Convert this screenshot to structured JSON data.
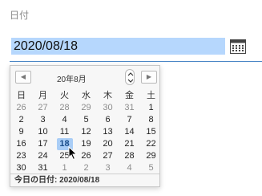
{
  "field": {
    "label": "日付",
    "value": "2020/08/18"
  },
  "calendar_button": {
    "icon": "calendar-icon"
  },
  "popup": {
    "month_label": "20年8月",
    "prev_icon": "triangle-left-icon",
    "next_icon": "triangle-right-icon",
    "weekdays": [
      "日",
      "月",
      "火",
      "水",
      "木",
      "金",
      "土"
    ],
    "weeks": [
      [
        {
          "d": "26",
          "o": true
        },
        {
          "d": "27",
          "o": true
        },
        {
          "d": "28",
          "o": true
        },
        {
          "d": "29",
          "o": true
        },
        {
          "d": "30",
          "o": true
        },
        {
          "d": "31",
          "o": true
        },
        {
          "d": "1"
        }
      ],
      [
        {
          "d": "2"
        },
        {
          "d": "3"
        },
        {
          "d": "4"
        },
        {
          "d": "5"
        },
        {
          "d": "6"
        },
        {
          "d": "7"
        },
        {
          "d": "8"
        }
      ],
      [
        {
          "d": "9"
        },
        {
          "d": "10"
        },
        {
          "d": "11"
        },
        {
          "d": "12"
        },
        {
          "d": "13"
        },
        {
          "d": "14"
        },
        {
          "d": "15"
        }
      ],
      [
        {
          "d": "16"
        },
        {
          "d": "17"
        },
        {
          "d": "18",
          "s": true
        },
        {
          "d": "19"
        },
        {
          "d": "20"
        },
        {
          "d": "21"
        },
        {
          "d": "22"
        }
      ],
      [
        {
          "d": "23"
        },
        {
          "d": "24"
        },
        {
          "d": "25"
        },
        {
          "d": "26"
        },
        {
          "d": "27"
        },
        {
          "d": "28"
        },
        {
          "d": "29"
        }
      ],
      [
        {
          "d": "30"
        },
        {
          "d": "31"
        },
        {
          "d": "1",
          "o": true
        },
        {
          "d": "2",
          "o": true
        },
        {
          "d": "3",
          "o": true
        },
        {
          "d": "4",
          "o": true
        },
        {
          "d": "5",
          "o": true
        }
      ]
    ],
    "today_label": "今日の日付: 2020/08/18"
  },
  "colors": {
    "selection": "#b6d7fd",
    "selected_day": "#a9cdf6",
    "accent_line": "#4a86c5"
  }
}
